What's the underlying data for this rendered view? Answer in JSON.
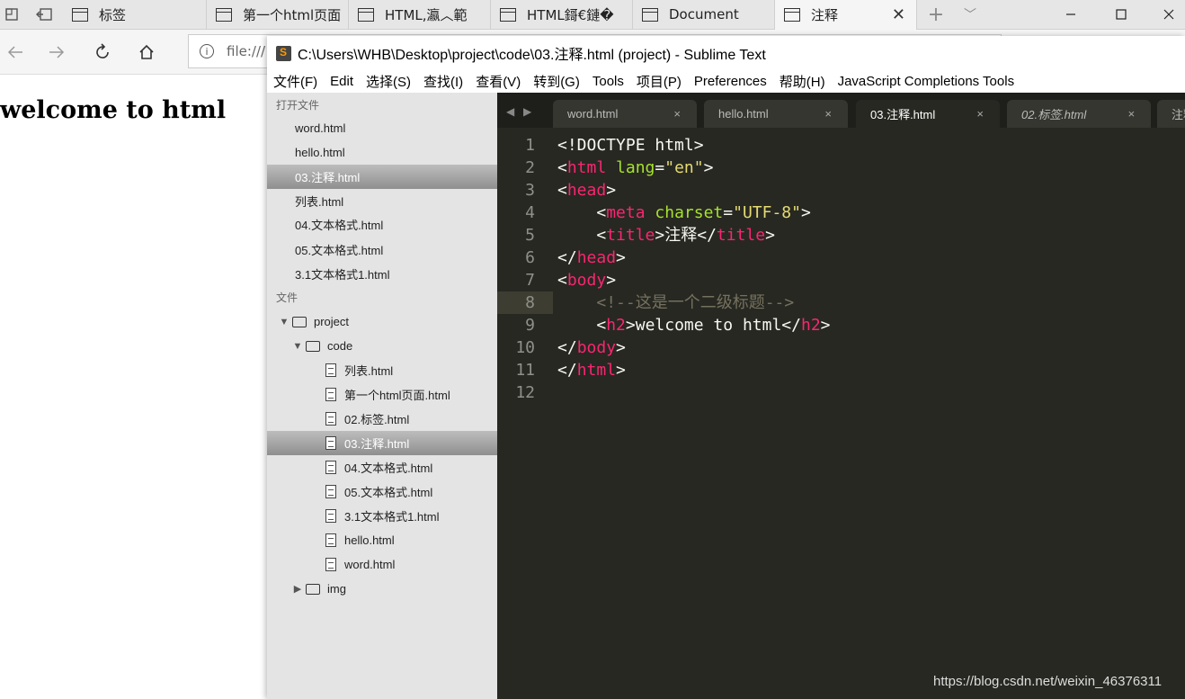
{
  "browser": {
    "tabs": [
      {
        "label": "标签"
      },
      {
        "label": "第一个html页面"
      },
      {
        "label": "HTML,瀛︿範"
      },
      {
        "label": "HTML鎶€鏈�"
      },
      {
        "label": "Document"
      },
      {
        "label": "注释",
        "active": true
      }
    ],
    "address": "file:///",
    "new_tab_symbol": "+",
    "tab_list_symbol": "﹀"
  },
  "page": {
    "heading": "welcome to html"
  },
  "sublime": {
    "title": "C:\\Users\\WHB\\Desktop\\project\\code\\03.注释.html (project) - Sublime Text",
    "menu": [
      "文件(F)",
      "Edit",
      "选择(S)",
      "查找(I)",
      "查看(V)",
      "转到(G)",
      "Tools",
      "项目(P)",
      "Preferences",
      "帮助(H)",
      "JavaScript Completions Tools"
    ],
    "sidebar": {
      "open_files_header": "打开文件",
      "open_files": [
        "word.html",
        "hello.html",
        "03.注释.html",
        "列表.html",
        "04.文本格式.html",
        "05.文本格式.html",
        "3.1文本格式1.html"
      ],
      "folders_header": "文件",
      "tree": {
        "project": "project",
        "code": "code",
        "files": [
          "列表.html",
          "第一个html页面.html",
          "02.标签.html",
          "03.注释.html",
          "04.文本格式.html",
          "05.文本格式.html",
          "3.1文本格式1.html",
          "hello.html",
          "word.html"
        ],
        "img": "img"
      }
    },
    "tabs": [
      {
        "label": "word.html"
      },
      {
        "label": "hello.html"
      },
      {
        "label": "03.注释.html",
        "active": true
      },
      {
        "label": "02.标签.html",
        "italic": true
      },
      {
        "label": "注释"
      }
    ],
    "close_symbol": "×",
    "line_numbers": [
      "1",
      "2",
      "3",
      "4",
      "5",
      "6",
      "7",
      "8",
      "9",
      "10",
      "11",
      "12"
    ],
    "code": {
      "l1": "<!DOCTYPE html>",
      "lt": "<",
      "gt": ">",
      "lt_slash": "</",
      "eq": "=",
      "tag_html": "html",
      "tag_head": "head",
      "tag_meta": "meta",
      "tag_title": "title",
      "tag_body": "body",
      "tag_h2": "h2",
      "attr_lang": "lang",
      "val_en": "\"en\"",
      "attr_charset": "charset",
      "val_utf8": "\"UTF-8\"",
      "title_text": "注释",
      "comment": "<!--这是一个二级标题-->",
      "h2_text": "welcome to html"
    }
  },
  "watermark": "https://blog.csdn.net/weixin_46376311"
}
